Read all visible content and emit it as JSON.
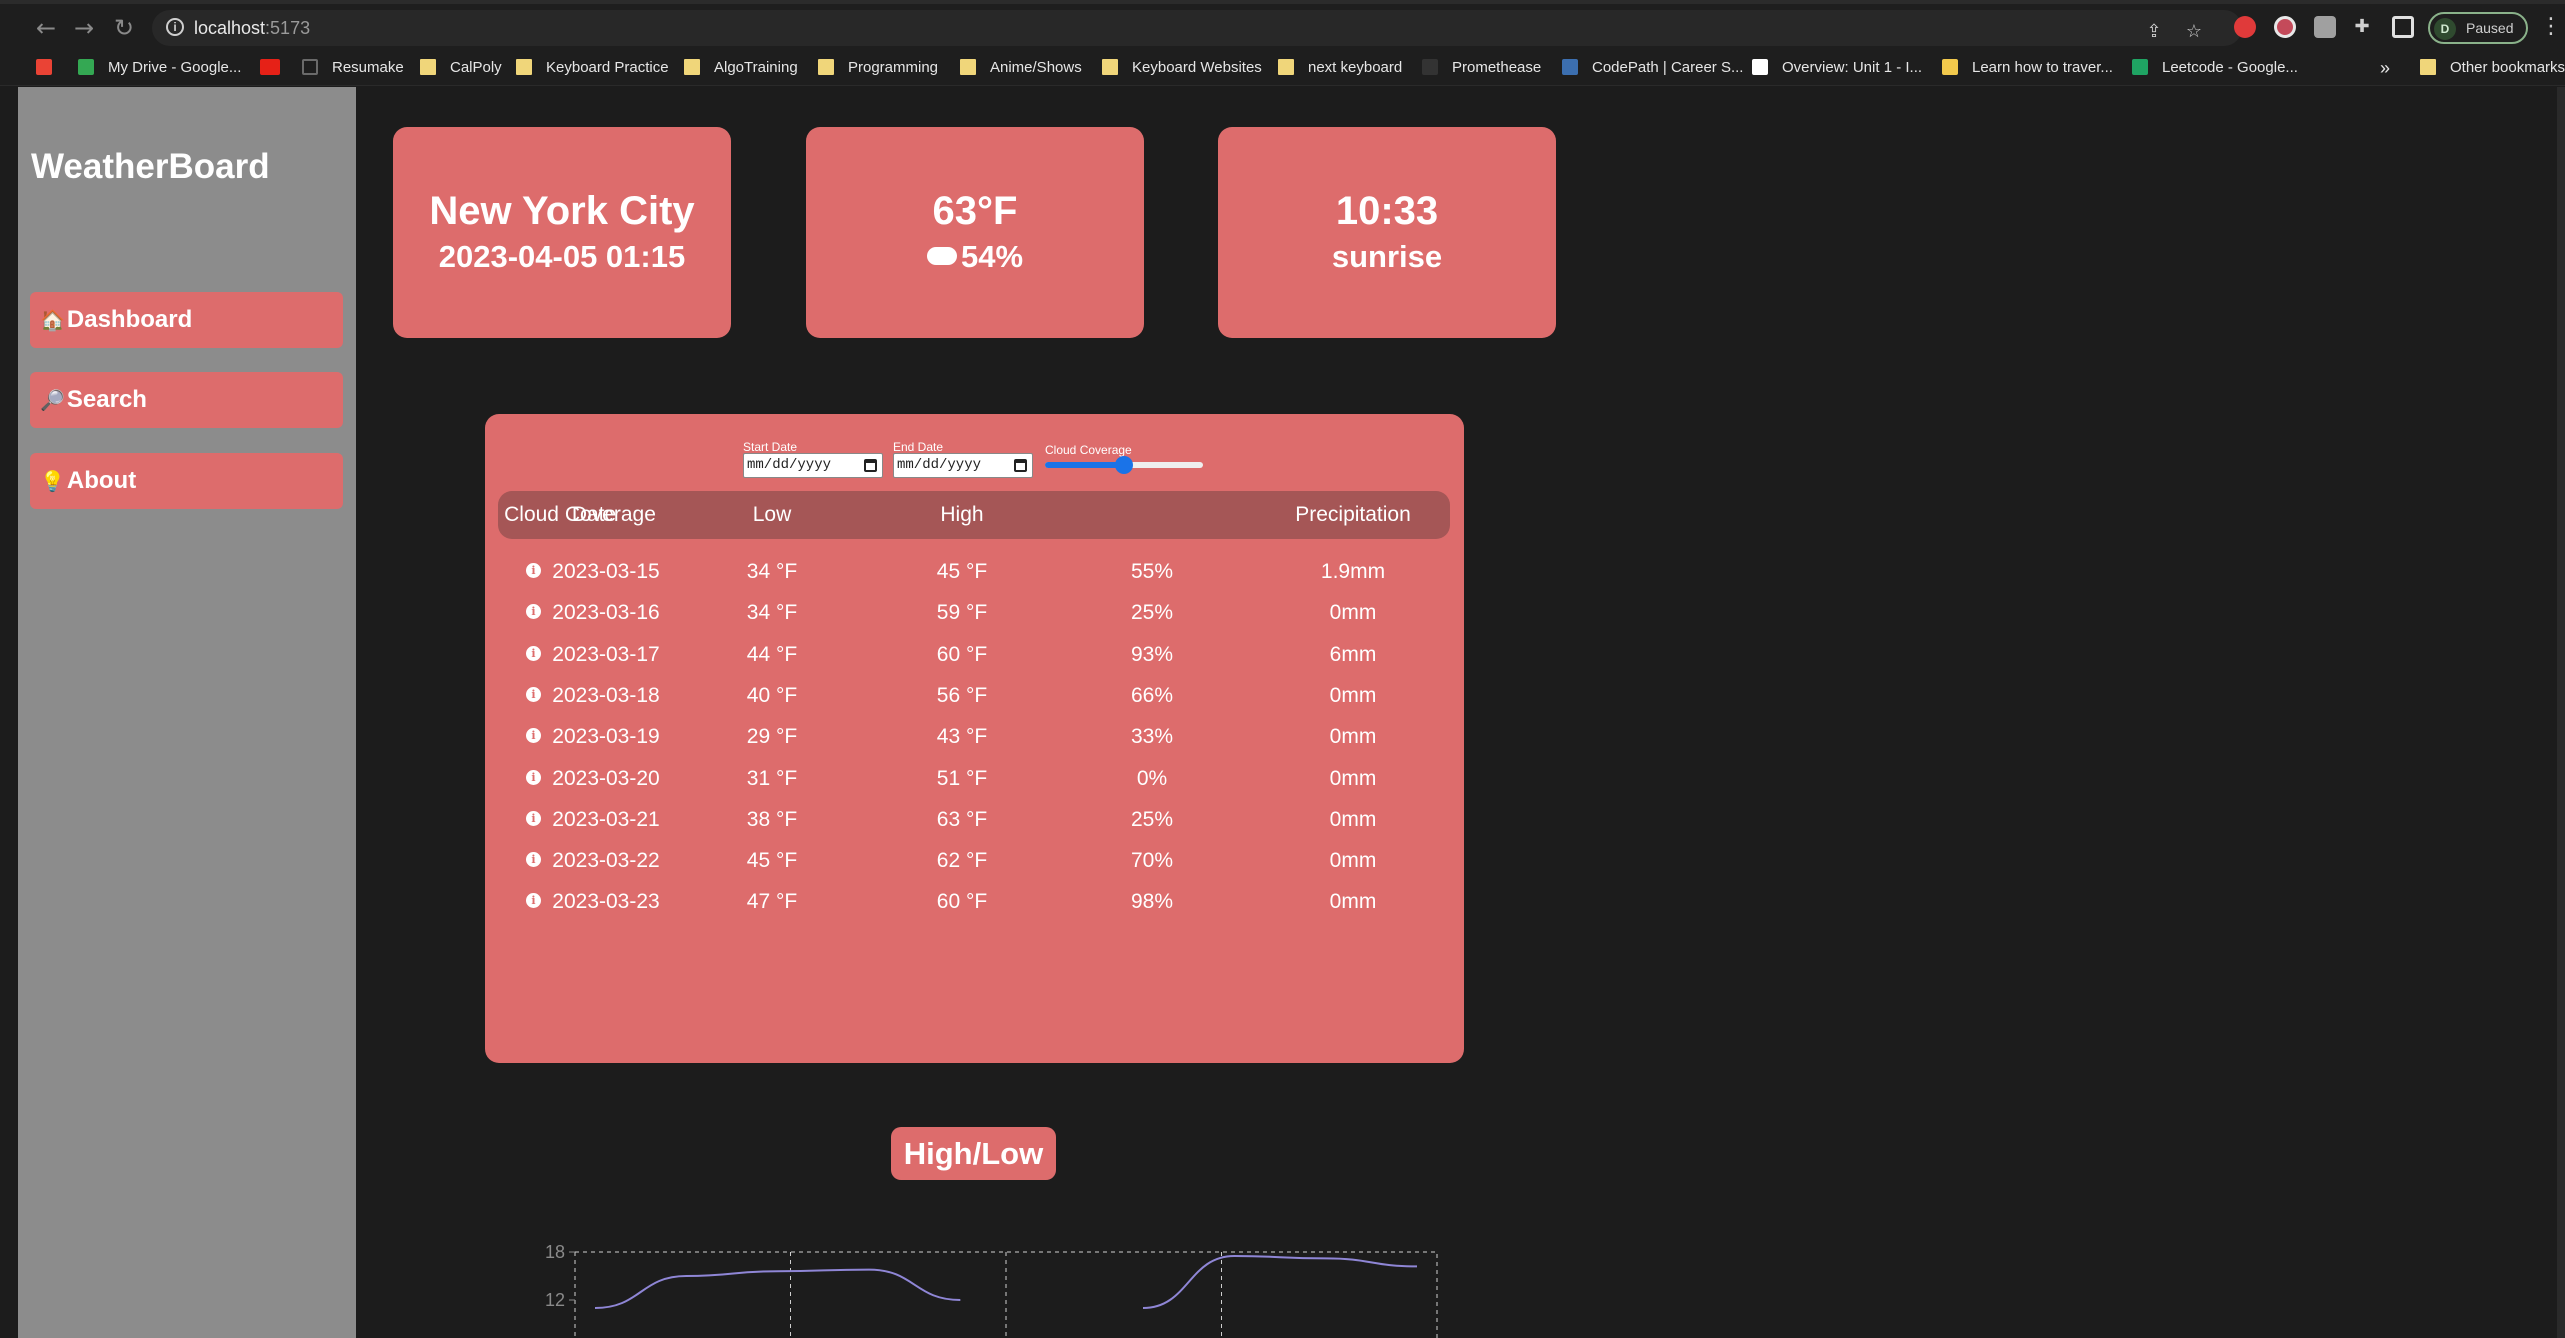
{
  "browser": {
    "url_host": "localhost",
    "url_port": ":5173",
    "profile_initial": "D",
    "profile_status": "Paused",
    "bookmarks": [
      {
        "label": "",
        "icon": "gmail-icon"
      },
      {
        "label": "My Drive - Google...",
        "icon": "drive-icon"
      },
      {
        "label": "",
        "icon": "youtube-icon"
      },
      {
        "label": "Resumake",
        "icon": "resumake-icon"
      },
      {
        "label": "CalPoly",
        "icon": "folder-icon"
      },
      {
        "label": "Keyboard Practice",
        "icon": "folder-icon"
      },
      {
        "label": "AlgoTraining",
        "icon": "folder-icon"
      },
      {
        "label": "Programming",
        "icon": "folder-icon"
      },
      {
        "label": "Anime/Shows",
        "icon": "folder-icon"
      },
      {
        "label": "Keyboard Websites",
        "icon": "folder-icon"
      },
      {
        "label": "next keyboard",
        "icon": "folder-icon"
      },
      {
        "label": "Promethease",
        "icon": "promethease-icon"
      },
      {
        "label": "CodePath | Career S...",
        "icon": "codepath-icon"
      },
      {
        "label": "Overview: Unit 1 - I...",
        "icon": "page-icon"
      },
      {
        "label": "Learn how to traver...",
        "icon": "learn-icon"
      },
      {
        "label": "Leetcode - Google...",
        "icon": "sheets-icon"
      },
      {
        "label": "»",
        "icon": ""
      },
      {
        "label": "Other bookmarks",
        "icon": "folder-icon"
      }
    ]
  },
  "sidebar": {
    "brand": "WeatherBoard",
    "items": [
      {
        "icon": "🏠",
        "label": "Dashboard"
      },
      {
        "icon": "🔎",
        "label": "Search"
      },
      {
        "icon": "💡",
        "label": "About"
      }
    ]
  },
  "cards": {
    "location": {
      "city": "New York City",
      "datetime": "2023-04-05 01:15"
    },
    "weather": {
      "temp": "63°F",
      "cloud": "54%"
    },
    "sun": {
      "time": "10:33",
      "event": "sunrise"
    }
  },
  "filters": {
    "start_label": "Start Date",
    "end_label": "End Date",
    "cloud_label": "Cloud Coverage",
    "date_placeholder": "mm/dd/yyyy",
    "cloud_value": 0.5
  },
  "table": {
    "headers": [
      "Date",
      "Low",
      "High",
      "Cloud Coverage",
      "Precipitation"
    ],
    "rows": [
      [
        "2023-03-15",
        "34 °F",
        "45 °F",
        "55%",
        "1.9mm"
      ],
      [
        "2023-03-16",
        "34 °F",
        "59 °F",
        "25%",
        "0mm"
      ],
      [
        "2023-03-17",
        "44 °F",
        "60 °F",
        "93%",
        "6mm"
      ],
      [
        "2023-03-18",
        "40 °F",
        "56 °F",
        "66%",
        "0mm"
      ],
      [
        "2023-03-19",
        "29 °F",
        "43 °F",
        "33%",
        "0mm"
      ],
      [
        "2023-03-20",
        "31 °F",
        "51 °F",
        "0%",
        "0mm"
      ],
      [
        "2023-03-21",
        "38 °F",
        "63 °F",
        "25%",
        "0mm"
      ],
      [
        "2023-03-22",
        "45 °F",
        "62 °F",
        "70%",
        "0mm"
      ],
      [
        "2023-03-23",
        "47 °F",
        "60 °F",
        "98%",
        "0mm"
      ]
    ]
  },
  "highlow": {
    "title": "High/Low",
    "chart_data": {
      "type": "line",
      "y_ticks": [
        "18",
        "12"
      ],
      "ylim": [
        6,
        18
      ],
      "series": [
        {
          "values": [
            11.0,
            15.0,
            15.6,
            15.8,
            12.0,
            null,
            11.0,
            17.5,
            17.2,
            16.2
          ]
        }
      ]
    }
  },
  "colors": {
    "accent": "#dd6c6c",
    "header_row": "#a55656",
    "sidebar": "#8c8c8c",
    "background": "#1c1c1c",
    "line": "#8f86d6"
  }
}
